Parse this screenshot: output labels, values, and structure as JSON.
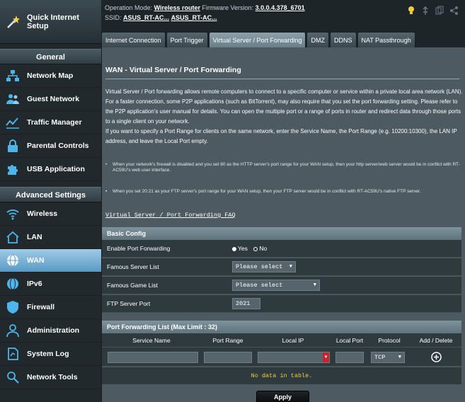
{
  "sidebar": {
    "quick_internet_setup": "Quick Internet Setup",
    "general_header": "General",
    "general_items": [
      {
        "label": "Network Map",
        "icon": "network-map-icon"
      },
      {
        "label": "Guest Network",
        "icon": "guest-network-icon"
      },
      {
        "label": "Traffic Manager",
        "icon": "traffic-manager-icon"
      },
      {
        "label": "Parental Controls",
        "icon": "parental-controls-icon"
      },
      {
        "label": "USB Application",
        "icon": "usb-application-icon"
      }
    ],
    "advanced_header": "Advanced Settings",
    "advanced_items": [
      {
        "label": "Wireless",
        "icon": "wireless-icon"
      },
      {
        "label": "LAN",
        "icon": "lan-icon"
      },
      {
        "label": "WAN",
        "icon": "wan-globe-icon",
        "active": true
      },
      {
        "label": "IPv6",
        "icon": "ipv6-icon"
      },
      {
        "label": "Firewall",
        "icon": "firewall-icon"
      },
      {
        "label": "Administration",
        "icon": "administration-icon"
      },
      {
        "label": "System Log",
        "icon": "system-log-icon"
      },
      {
        "label": "Network Tools",
        "icon": "network-tools-icon"
      }
    ]
  },
  "topbar": {
    "op_mode_label": "Operation Mode:",
    "op_mode_value": "Wireless router",
    "firmware_label": "Firmware Version:",
    "firmware_value": "3.0.0.4.378_6701",
    "ssid_label": "SSID:",
    "ssid_1": "ASUS_RT-AC...",
    "ssid_2": "ASUS_RT-AC..."
  },
  "tabs": [
    {
      "label": "Internet Connection",
      "active": false
    },
    {
      "label": "Port Trigger",
      "active": false
    },
    {
      "label": "Virtual Server / Port Forwarding",
      "active": true
    },
    {
      "label": "DMZ",
      "active": false
    },
    {
      "label": "DDNS",
      "active": false
    },
    {
      "label": "NAT Passthrough",
      "active": false
    }
  ],
  "main": {
    "title": "WAN - Virtual Server / Port Forwarding",
    "description": "Virtual Server / Port forwarding allows remote computers to connect to a specific computer or service within a private local area network (LAN). For a faster connection, some P2P applications (such as BitTorrent), may also require that you set the port forwarding setting. Please refer to the P2P application's user manual for details. You can open the multiple port or a range of ports in router and redirect data through those ports to a single client on your network.",
    "description2": "If you want to specify a Port Range for clients on the same network, enter the Service Name, the Port Range (e.g. 10200:10300), the LAN IP address, and leave the Local Port empty.",
    "note1": "When your network's firewall is disabled and you set 80 as the HTTP server's port range for your WAN setup, then your http server/web server would be in conflict with RT-AC59U's web user interface.",
    "note2": "When you set 20:21 as your FTP server's port range for your WAN setup, then your FTP server would be in conflict with RT-AC59U's native FTP server.",
    "faq_link": "Virtual Server / Port Forwarding FAQ"
  },
  "basic_config": {
    "header": "Basic Config",
    "enable_label": "Enable Port Forwarding",
    "yes_label": "Yes",
    "no_label": "No",
    "enabled": "Yes",
    "famous_server_label": "Famous Server List",
    "famous_server_value": "Please select",
    "famous_game_label": "Famous Game List",
    "famous_game_value": "Please select",
    "ftp_port_label": "FTP Server Port",
    "ftp_port_value": "2021"
  },
  "pf_list": {
    "header": "Port Forwarding List (Max Limit : 32)",
    "columns": [
      "Service Name",
      "Port Range",
      "Local IP",
      "Local Port",
      "Protocol",
      "Add / Delete"
    ],
    "protocol_value": "TCP",
    "empty_text": "No data in table."
  },
  "apply_label": "Apply"
}
